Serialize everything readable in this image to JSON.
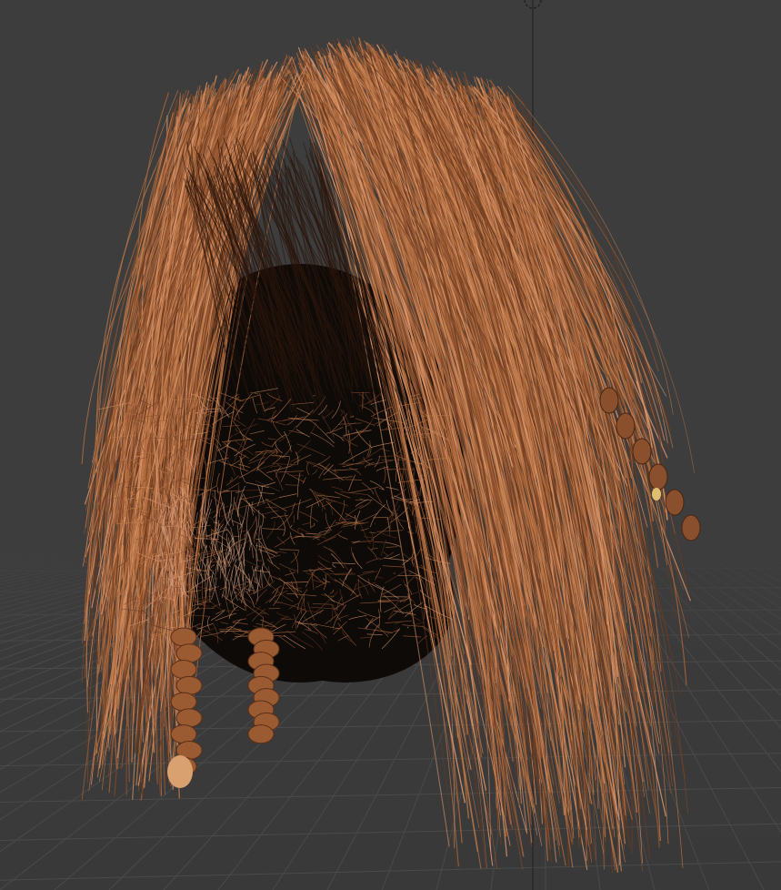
{
  "viewport": {
    "background_color": "#3d3d3d",
    "grid_color": "#4a4a4a",
    "axis_line_color": "#262626",
    "cursor_icon": "3d-cursor-icon",
    "subject": {
      "hair_colors": [
        "#8a4f2c",
        "#a8643a",
        "#c27a48",
        "#6b3a1f",
        "#d9956a"
      ],
      "head_color": "#0e0a08"
    }
  }
}
